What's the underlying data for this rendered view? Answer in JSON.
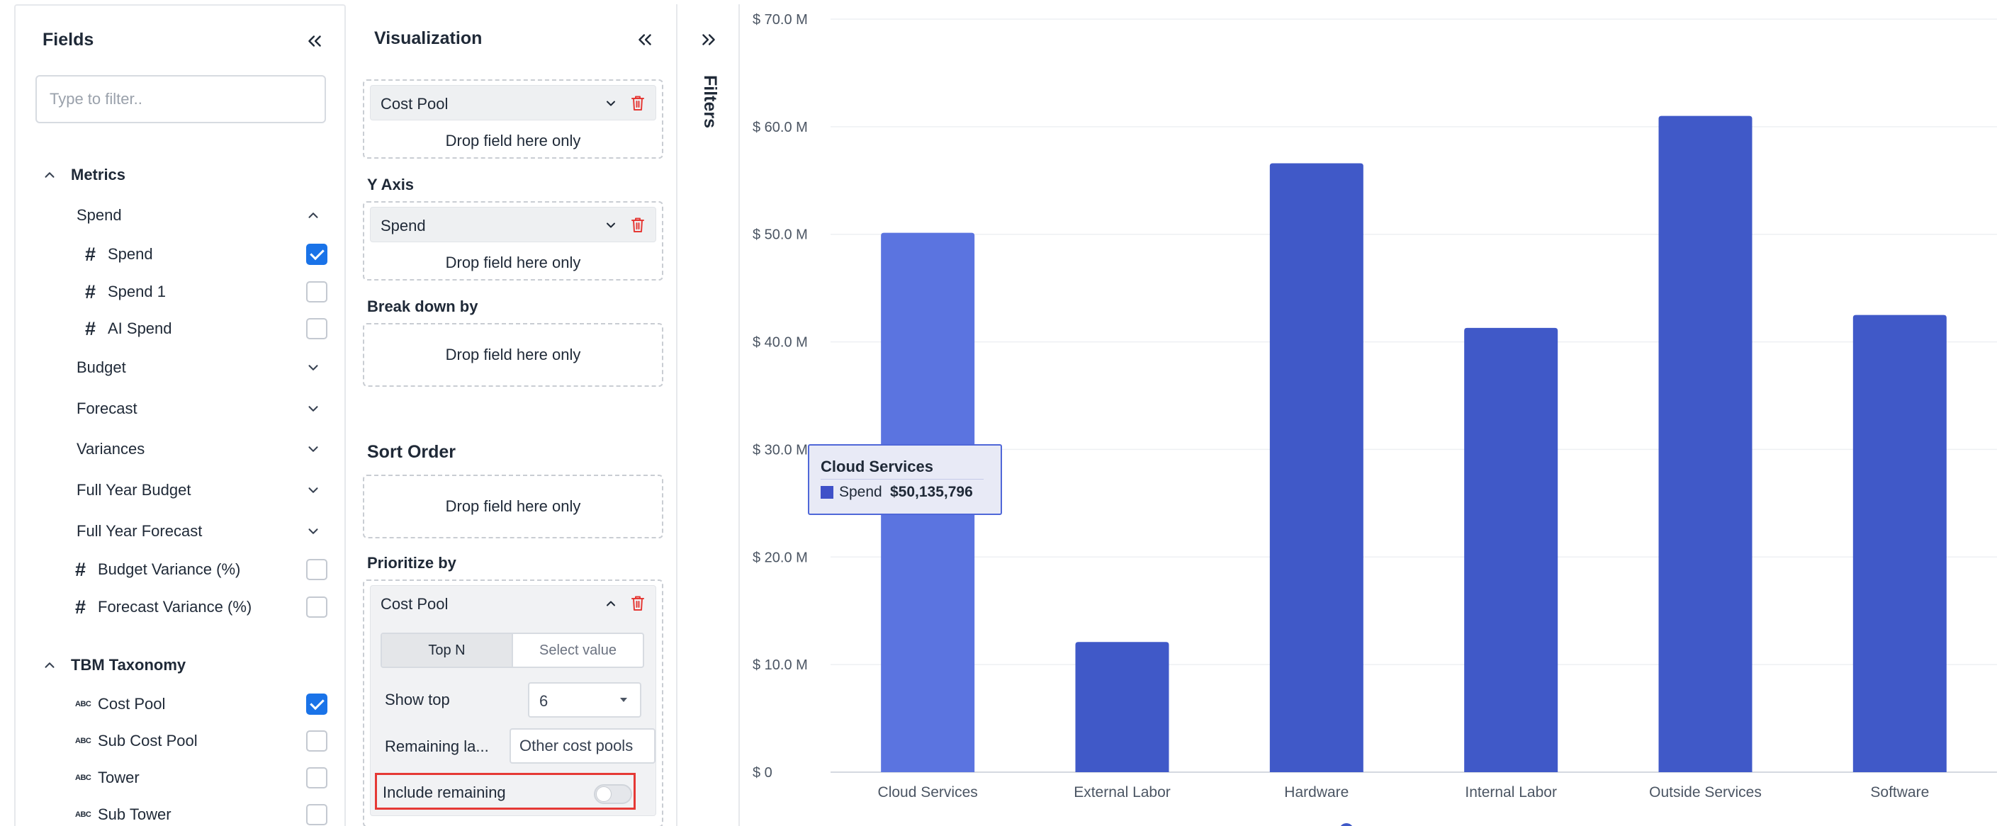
{
  "fields_panel": {
    "title": "Fields",
    "filter_placeholder": "Type to filter..",
    "metrics_group": "Metrics",
    "spend_group": "Spend",
    "spend_items": [
      {
        "label": "Spend",
        "checked": true
      },
      {
        "label": "Spend 1",
        "checked": false
      },
      {
        "label": "AI Spend",
        "checked": false
      }
    ],
    "collapsed_groups": [
      "Budget",
      "Forecast",
      "Variances",
      "Full Year Budget",
      "Full Year Forecast"
    ],
    "variance_items": [
      {
        "label": "Budget Variance (%)",
        "checked": false
      },
      {
        "label": "Forecast Variance (%)",
        "checked": false
      }
    ],
    "taxonomy_group": "TBM Taxonomy",
    "taxonomy_items": [
      {
        "label": "Cost Pool",
        "checked": true
      },
      {
        "label": "Sub Cost Pool",
        "checked": false
      },
      {
        "label": "Tower",
        "checked": false
      },
      {
        "label": "Sub Tower",
        "checked": false
      }
    ]
  },
  "viz_panel": {
    "title": "Visualization",
    "x_field": "Cost Pool",
    "drop_hint": "Drop field here only",
    "y_axis_label": "Y Axis",
    "y_field": "Spend",
    "breakdown_label": "Break down by",
    "sort_label": "Sort Order",
    "prioritize_label": "Prioritize by",
    "prioritize_field": "Cost Pool",
    "seg_top_n": "Top N",
    "seg_select_value": "Select value",
    "show_top_label": "Show top",
    "show_top_value": "6",
    "remaining_label": "Remaining la...",
    "remaining_value": "Other cost pools",
    "include_remaining_label": "Include remaining",
    "include_remaining_on": false
  },
  "filters_panel": {
    "title": "Filters"
  },
  "colors": {
    "bar": "#4059c8",
    "bar_highlight": "#5b74e0",
    "checkbox": "#1a73e8",
    "trash": "#e53935"
  },
  "tooltip": {
    "title": "Cloud Services",
    "series": "Spend",
    "value": "$50,135,796"
  },
  "chart_data": {
    "type": "bar",
    "categories": [
      "Cloud Services",
      "External Labor",
      "Hardware",
      "Internal Labor",
      "Outside Services",
      "Software"
    ],
    "series": [
      {
        "name": "Spend",
        "values": [
          50135796,
          12100000,
          56600000,
          41300000,
          61000000,
          42500000
        ]
      }
    ],
    "ylim": [
      0,
      70000000
    ],
    "yticks": [
      0,
      10000000,
      20000000,
      30000000,
      40000000,
      50000000,
      60000000,
      70000000
    ],
    "ytick_labels": [
      "$ 0",
      "$ 10.0 M",
      "$ 20.0 M",
      "$ 30.0 M",
      "$ 40.0 M",
      "$ 50.0 M",
      "$ 60.0 M",
      "$ 70.0 M"
    ],
    "highlighted_category": "Cloud Services",
    "grid": true
  }
}
